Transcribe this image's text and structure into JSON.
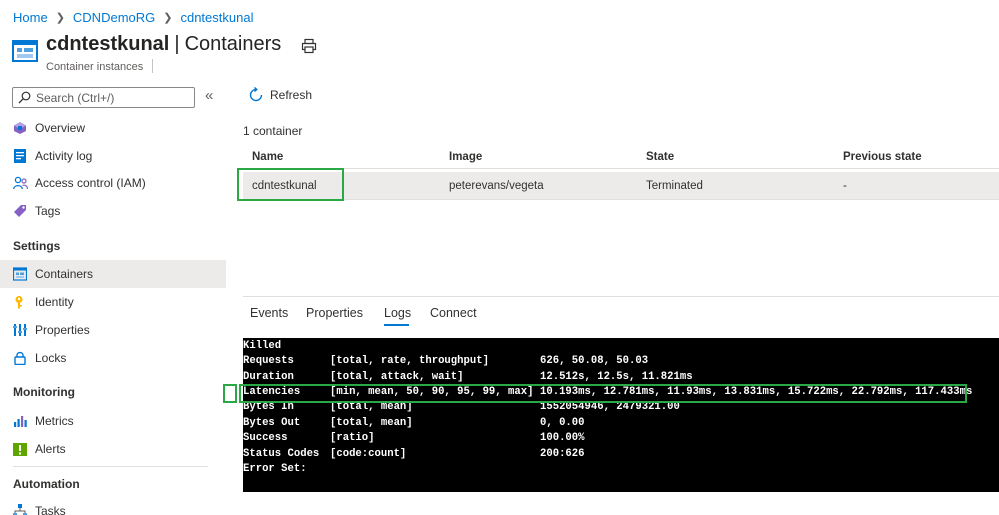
{
  "breadcrumb": [
    "Home",
    "CDNDemoRG",
    "cdntestkunal"
  ],
  "header": {
    "resource_name": "cdntestkunal",
    "separator": "|",
    "blade_name": "Containers",
    "subtitle": "Container instances"
  },
  "sidebar": {
    "search_placeholder": "Search (Ctrl+/)",
    "collapse_label": "«",
    "items": [
      {
        "label": "Overview",
        "icon": "cloud-icon"
      },
      {
        "label": "Activity log",
        "icon": "activity-log-icon"
      },
      {
        "label": "Access control (IAM)",
        "icon": "people-icon"
      },
      {
        "label": "Tags",
        "icon": "tag-icon"
      }
    ],
    "sections": [
      {
        "title": "Settings",
        "items": [
          {
            "label": "Containers",
            "icon": "containers-icon",
            "active": true
          },
          {
            "label": "Identity",
            "icon": "identity-icon"
          },
          {
            "label": "Properties",
            "icon": "properties-icon"
          },
          {
            "label": "Locks",
            "icon": "lock-icon"
          }
        ]
      },
      {
        "title": "Monitoring",
        "items": [
          {
            "label": "Metrics",
            "icon": "metrics-icon"
          },
          {
            "label": "Alerts",
            "icon": "alerts-icon"
          }
        ]
      },
      {
        "title": "Automation",
        "items": [
          {
            "label": "Tasks",
            "icon": "tasks-icon"
          }
        ]
      }
    ]
  },
  "toolbar": {
    "refresh_label": "Refresh"
  },
  "container_count": "1 container",
  "table": {
    "columns": [
      "Name",
      "Image",
      "State",
      "Previous state"
    ],
    "rows": [
      {
        "name": "cdntestkunal",
        "image": "peterevans/vegeta",
        "state": "Terminated",
        "previous_state": "-"
      }
    ]
  },
  "tabs": [
    "Events",
    "Properties",
    "Logs",
    "Connect"
  ],
  "active_tab": "Logs",
  "logs": [
    {
      "c1": "Killed",
      "c2": "",
      "c3": ""
    },
    {
      "c1": "Requests",
      "c2": "[total, rate, throughput]",
      "c3": "626, 50.08, 50.03"
    },
    {
      "c1": "Duration",
      "c2": "[total, attack, wait]",
      "c3": "12.512s, 12.5s, 11.821ms"
    },
    {
      "c1": "Latencies",
      "c2": "[min, mean, 50, 90, 95, 99, max]",
      "c3": "10.193ms, 12.781ms, 11.93ms, 13.831ms, 15.722ms, 22.792ms, 117.433ms"
    },
    {
      "c1": "Bytes In",
      "c2": "[total, mean]",
      "c3": "1552054946, 2479321.00"
    },
    {
      "c1": "Bytes Out",
      "c2": "[total, mean]",
      "c3": "0, 0.00"
    },
    {
      "c1": "Success",
      "c2": "[ratio]",
      "c3": "100.00%"
    },
    {
      "c1": "Status Codes",
      "c2": "[code:count]",
      "c3": "200:626"
    },
    {
      "c1": "Error Set:",
      "c2": "",
      "c3": ""
    }
  ],
  "colors": {
    "accent": "#0078d4",
    "highlight": "#2aa845",
    "active_row": "#edebe9",
    "console_bg": "#000000"
  }
}
